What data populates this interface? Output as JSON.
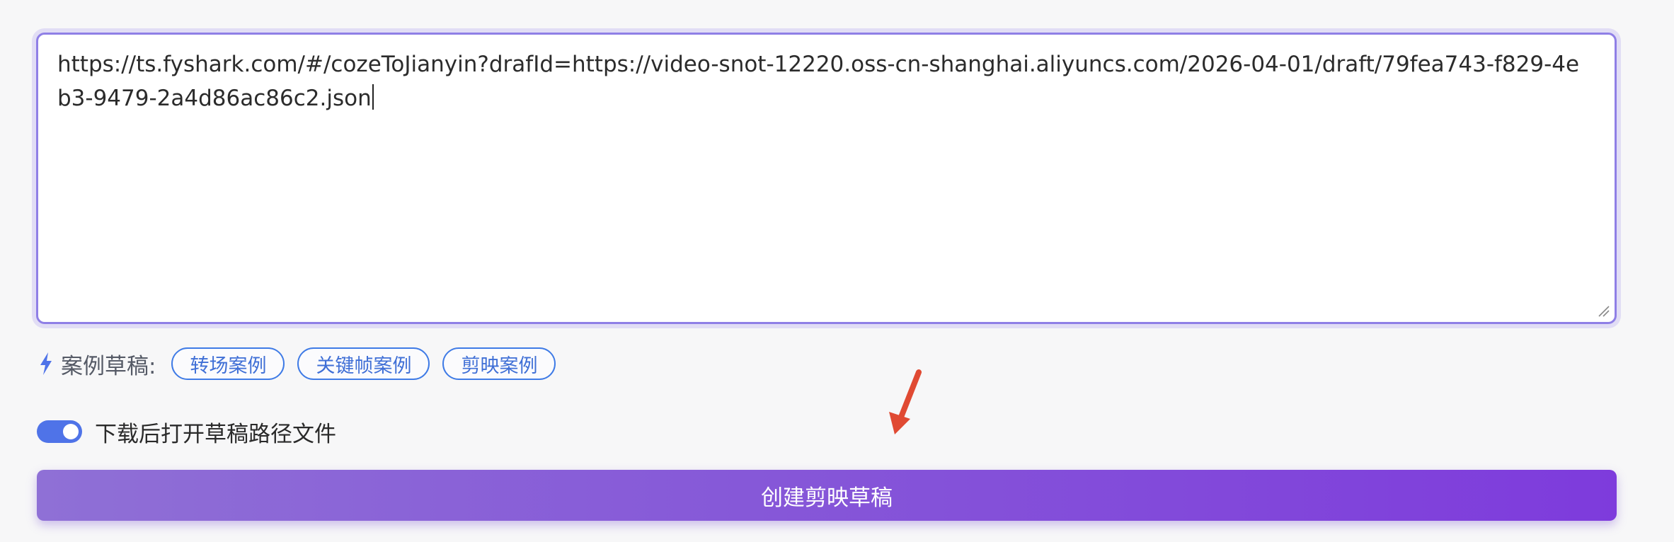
{
  "url_input": {
    "value": "https://ts.fyshark.com/#/cozeToJianyin?drafId=https://video-snot-12220.oss-cn-shanghai.aliyuncs.com/2026-04-01/draft/79fea743-f829-4eb3-9479-2a4d86ac86c2.json"
  },
  "samples": {
    "icon": "bolt-icon",
    "label": "案例草稿:",
    "chips": [
      {
        "label": "转场案例"
      },
      {
        "label": "关键帧案例"
      },
      {
        "label": "剪映案例"
      }
    ]
  },
  "open_after_download": {
    "enabled": true,
    "label": "下载后打开草稿路径文件"
  },
  "create_button": {
    "label": "创建剪映草稿"
  },
  "colors": {
    "accent_blue": "#3f7be6",
    "toggle_on": "#4f73e8",
    "button_gradient_start": "#8f70d6",
    "button_gradient_end": "#7e3bdc",
    "arrow": "#e04a33"
  }
}
